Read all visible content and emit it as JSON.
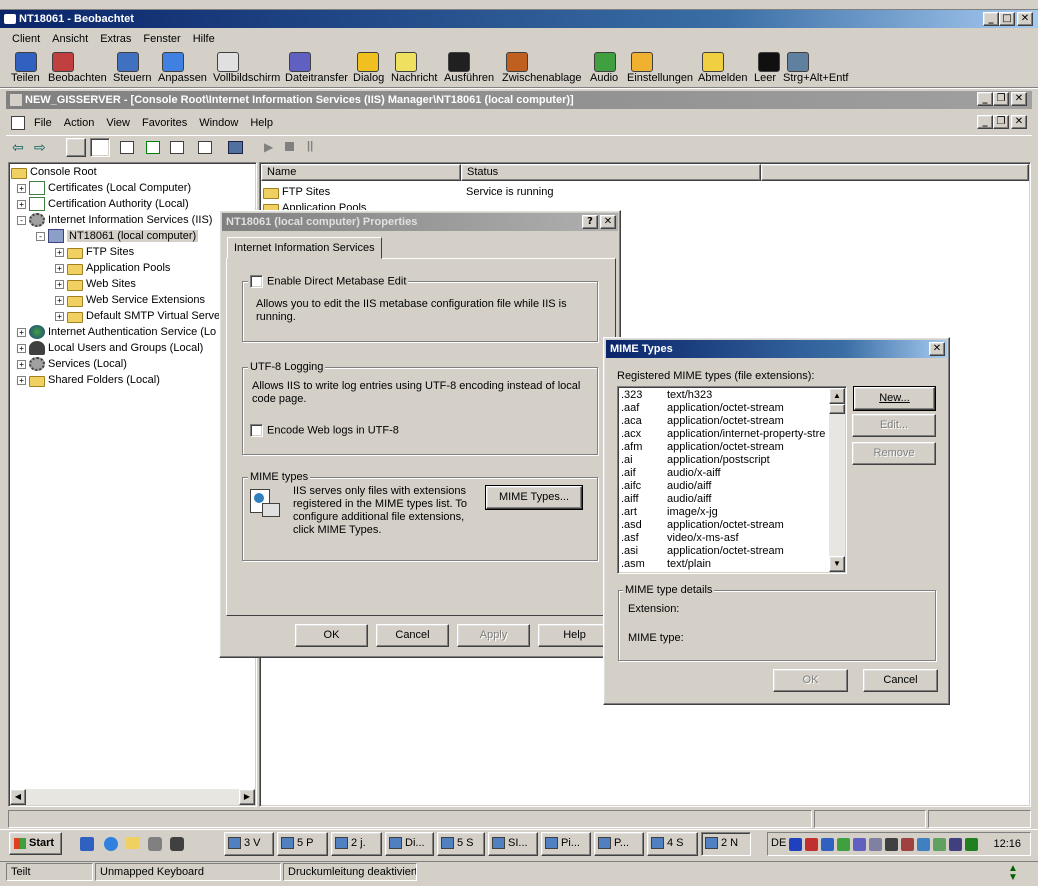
{
  "top_title": "NT18061 - Beobachtet",
  "top_menu": [
    "Client",
    "Ansicht",
    "Extras",
    "Fenster",
    "Hilfe"
  ],
  "toolbar": [
    {
      "label": "Teilen",
      "icon": "share-icon",
      "color": "#3060c0"
    },
    {
      "label": "Beobachten",
      "icon": "watch-icon",
      "color": "#c04040"
    },
    {
      "label": "Steuern",
      "icon": "control-icon",
      "color": "#4070c0"
    },
    {
      "label": "Anpassen",
      "icon": "adjust-icon",
      "color": "#4080e0"
    },
    {
      "label": "Vollbildschirm",
      "icon": "fullscreen-icon",
      "color": "#e0e0e0"
    },
    {
      "label": "Dateitransfer",
      "icon": "file-transfer-icon",
      "color": "#6060c0"
    },
    {
      "label": "Dialog",
      "icon": "dialog-icon",
      "color": "#f0c020"
    },
    {
      "label": "Nachricht",
      "icon": "message-icon",
      "color": "#f0e060"
    },
    {
      "label": "Ausführen",
      "icon": "run-icon",
      "color": "#202020"
    },
    {
      "label": "Zwischenablage",
      "icon": "clipboard-icon",
      "color": "#c06020"
    },
    {
      "label": "Audio",
      "icon": "audio-icon",
      "color": "#40a040"
    },
    {
      "label": "Einstellungen",
      "icon": "settings-icon",
      "color": "#f0b030"
    },
    {
      "label": "Abmelden",
      "icon": "logout-icon",
      "color": "#f0d040"
    },
    {
      "label": "Leer",
      "icon": "blank-icon",
      "color": "#101010"
    },
    {
      "label": "Strg+Alt+Entf",
      "icon": "ctrl-alt-del-icon",
      "color": "#6080a0"
    }
  ],
  "mmc_title": "NEW_GISSERVER - [Console Root\\Internet Information Services (IIS) Manager\\NT18061 (local computer)]",
  "mmc_menu": [
    "File",
    "Action",
    "View",
    "Favorites",
    "Window",
    "Help"
  ],
  "tree": [
    {
      "label": "Console Root",
      "icon": "folder",
      "level": 0,
      "exp": ""
    },
    {
      "label": "Certificates (Local Computer)",
      "icon": "cert",
      "level": 1,
      "exp": "+"
    },
    {
      "label": "Certification Authority (Local)",
      "icon": "cert",
      "level": 1,
      "exp": "+"
    },
    {
      "label": "Internet Information Services (IIS)",
      "icon": "gear",
      "level": 1,
      "exp": "-"
    },
    {
      "label": "NT18061 (local computer)",
      "icon": "comp",
      "level": 2,
      "exp": "-",
      "selected": true
    },
    {
      "label": "FTP Sites",
      "icon": "folder",
      "level": 3,
      "exp": "+"
    },
    {
      "label": "Application Pools",
      "icon": "folder",
      "level": 3,
      "exp": "+"
    },
    {
      "label": "Web Sites",
      "icon": "folder",
      "level": 3,
      "exp": "+"
    },
    {
      "label": "Web Service Extensions",
      "icon": "folder",
      "level": 3,
      "exp": "+"
    },
    {
      "label": "Default SMTP Virtual Server",
      "icon": "folder",
      "level": 3,
      "exp": "+"
    },
    {
      "label": "Internet Authentication Service (Lo",
      "icon": "glob",
      "level": 1,
      "exp": "+"
    },
    {
      "label": "Local Users and Groups (Local)",
      "icon": "users",
      "level": 1,
      "exp": "+"
    },
    {
      "label": "Services (Local)",
      "icon": "gear",
      "level": 1,
      "exp": "+"
    },
    {
      "label": "Shared Folders (Local)",
      "icon": "folder",
      "level": 1,
      "exp": "+"
    }
  ],
  "list": {
    "col_name": "Name",
    "col_status": "Status",
    "rows": [
      {
        "name": "FTP Sites",
        "status": "Service is running"
      },
      {
        "name": "Application Pools",
        "status": ""
      }
    ]
  },
  "props": {
    "title": "NT18061 (local computer) Properties",
    "tab": "Internet Information Services",
    "metabase_check": "Enable Direct Metabase Edit",
    "metabase_desc": "Allows you to edit the IIS metabase configuration file while IIS is running.",
    "utf_legend": "UTF-8 Logging",
    "utf_desc": "Allows IIS to write log entries using UTF-8 encoding instead of local code page.",
    "utf_check": "Encode Web logs in UTF-8",
    "mime_legend": "MIME types",
    "mime_desc": "IIS serves only files with extensions registered in the MIME types list. To configure additional file extensions, click MIME Types.",
    "mime_button": "MIME Types...",
    "ok": "OK",
    "cancel": "Cancel",
    "apply": "Apply",
    "help": "Help"
  },
  "mime": {
    "title": "MIME Types",
    "list_label": "Registered MIME types (file extensions):",
    "entries": [
      {
        "ext": ".323",
        "type": "text/h323"
      },
      {
        "ext": ".aaf",
        "type": "application/octet-stream"
      },
      {
        "ext": ".aca",
        "type": "application/octet-stream"
      },
      {
        "ext": ".acx",
        "type": "application/internet-property-stre"
      },
      {
        "ext": ".afm",
        "type": "application/octet-stream"
      },
      {
        "ext": ".ai",
        "type": "application/postscript"
      },
      {
        "ext": ".aif",
        "type": "audio/x-aiff"
      },
      {
        "ext": ".aifc",
        "type": "audio/aiff"
      },
      {
        "ext": ".aiff",
        "type": "audio/aiff"
      },
      {
        "ext": ".art",
        "type": "image/x-jg"
      },
      {
        "ext": ".asd",
        "type": "application/octet-stream"
      },
      {
        "ext": ".asf",
        "type": "video/x-ms-asf"
      },
      {
        "ext": ".asi",
        "type": "application/octet-stream"
      },
      {
        "ext": ".asm",
        "type": "text/plain"
      }
    ],
    "new": "New...",
    "edit": "Edit...",
    "remove": "Remove",
    "details_legend": "MIME type details",
    "extension_label": "Extension:",
    "mimetype_label": "MIME type:",
    "ok": "OK",
    "cancel": "Cancel"
  },
  "taskbar": {
    "start": "Start",
    "buttons": [
      "3 V",
      "5 P",
      "2 j.",
      "Di...",
      "5 S",
      "SI...",
      "Pi...",
      "P...",
      "4 S",
      "2 N"
    ],
    "lang": "DE",
    "clock": "12:16"
  },
  "status": {
    "mode": "Teilt",
    "keyboard": "Unmapped Keyboard",
    "redirect": "Druckumleitung deaktiviert"
  }
}
